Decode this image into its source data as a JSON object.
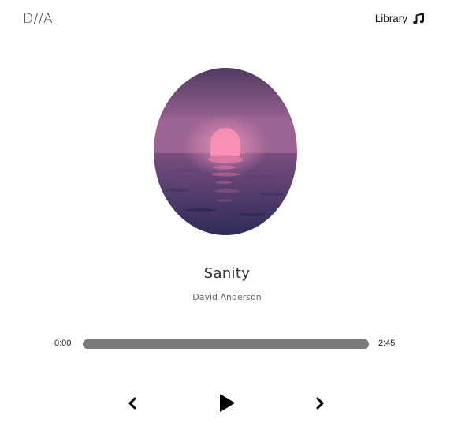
{
  "header": {
    "logo": "D//A",
    "library_label": "Library",
    "library_icon": "music-note-icon"
  },
  "track": {
    "title": "Sanity",
    "artist": "David Anderson",
    "cover_icon": "sunset-over-water-artwork"
  },
  "player": {
    "current_time": "0:00",
    "total_time": "2:45",
    "progress": 0,
    "prev_icon": "chevron-left-icon",
    "play_icon": "play-icon",
    "next_icon": "chevron-right-icon"
  },
  "colors": {
    "background": "#ffffff",
    "progress_track": "#7a7a7a",
    "text": "#222222"
  }
}
